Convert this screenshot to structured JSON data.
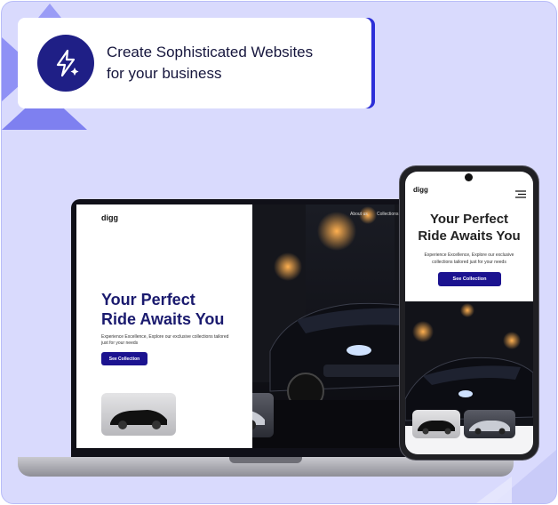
{
  "banner": {
    "line1": "Create Sophisticated Websites",
    "line2": "for your business",
    "icon": "lightning-sparkle-icon"
  },
  "site": {
    "brand": "digg",
    "nav": [
      "About us",
      "Collections"
    ],
    "hero_title_line1": "Your Perfect",
    "hero_title_line2": "Ride Awaits You",
    "hero_subtitle": "Experience Excellence, Explore our exclusive collections tailored just for your needs",
    "cta_label": "See Collection"
  },
  "colors": {
    "background": "#d9dafd",
    "accent": "#1c1390",
    "banner_icon_bg": "#1f1f86",
    "title": "#1a1a6e"
  }
}
